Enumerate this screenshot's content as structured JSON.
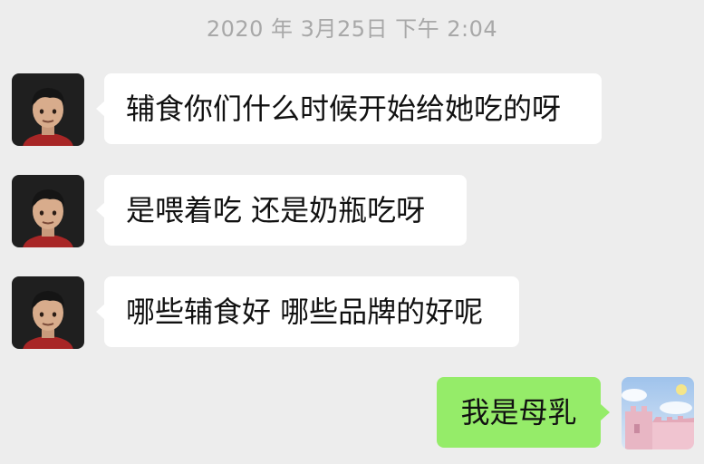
{
  "chat": {
    "timestamp": "2020 年 3月25日 下午 2:04",
    "messages": [
      {
        "sender": "other",
        "avatar_icon": "cartoon-boy-avatar-icon",
        "text": "辅食你们什么时候开始给她吃的呀"
      },
      {
        "sender": "other",
        "avatar_icon": "cartoon-boy-avatar-icon",
        "text": "是喂着吃 还是奶瓶吃呀"
      },
      {
        "sender": "other",
        "avatar_icon": "cartoon-boy-avatar-icon",
        "text": "哪些辅食好 哪些品牌的好呢"
      },
      {
        "sender": "self",
        "avatar_icon": "pink-castle-avatar-icon",
        "text": "我是母乳"
      }
    ]
  },
  "colors": {
    "background": "#ededed",
    "incoming_bubble": "#ffffff",
    "outgoing_bubble": "#95ec69",
    "timestamp_text": "#a8a8a8"
  }
}
